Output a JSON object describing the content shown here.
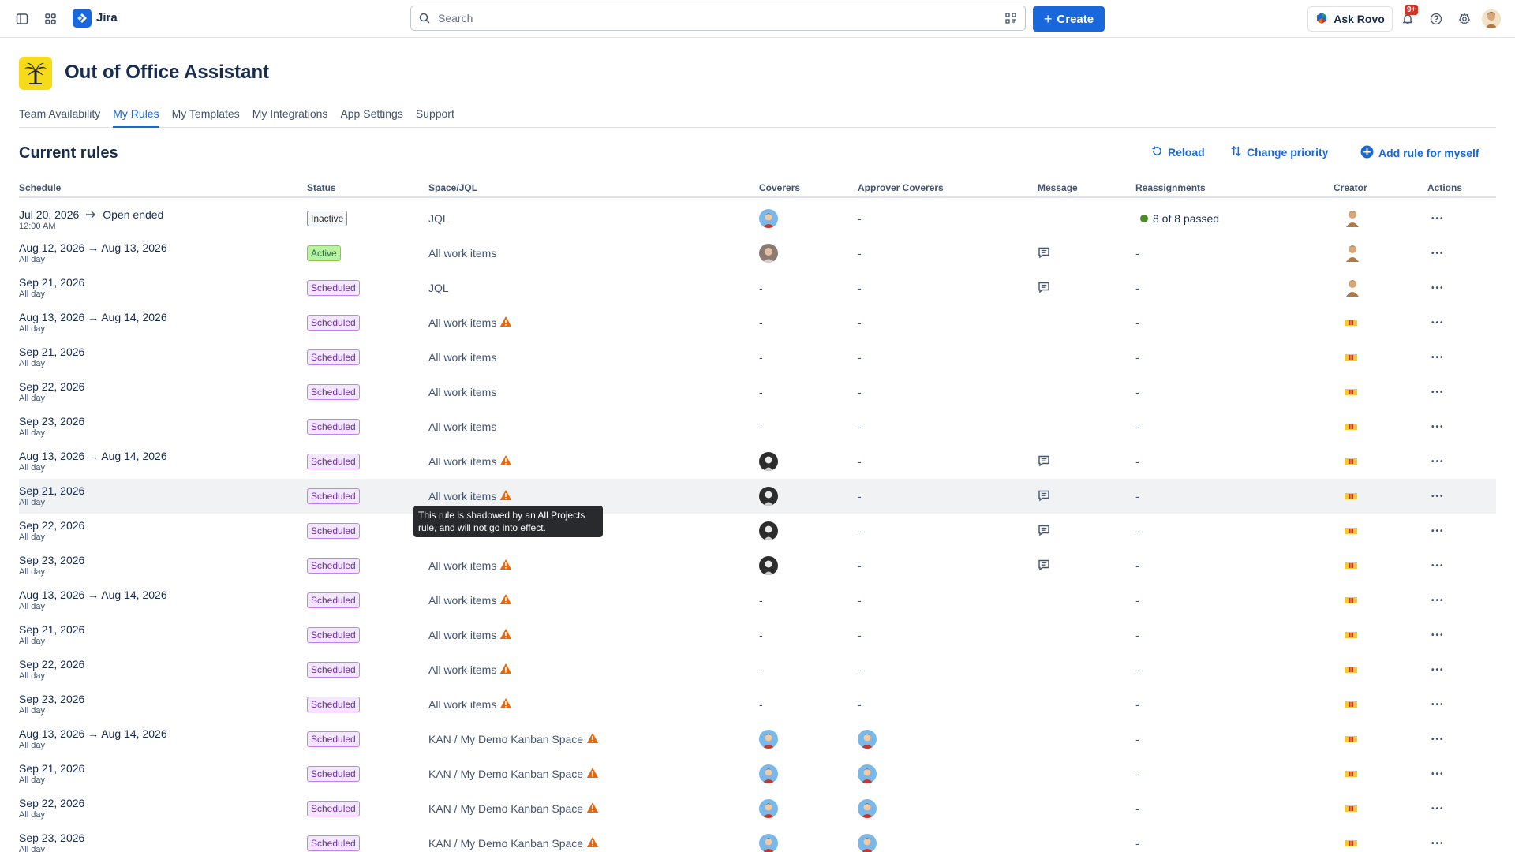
{
  "app": {
    "name": "Jira"
  },
  "search": {
    "placeholder": "Search"
  },
  "top": {
    "create_label": "Create",
    "ask_rovo_label": "Ask Rovo",
    "notifications_badge": "9+"
  },
  "page": {
    "title": "Out of Office Assistant",
    "section_title": "Current rules"
  },
  "tabs": [
    {
      "label": "Team Availability",
      "active": false
    },
    {
      "label": "My Rules",
      "active": true
    },
    {
      "label": "My Templates",
      "active": false
    },
    {
      "label": "My Integrations",
      "active": false
    },
    {
      "label": "App Settings",
      "active": false
    },
    {
      "label": "Support",
      "active": false
    }
  ],
  "actions": {
    "reload": "Reload",
    "change_priority": "Change priority",
    "add_rule": "Add rule for myself"
  },
  "columns": [
    "Schedule",
    "Status",
    "Space/JQL",
    "Coverers",
    "Approver Coverers",
    "Message",
    "Reassignments",
    "Creator",
    "Actions"
  ],
  "tooltip": {
    "text": "This rule is shadowed by an All Projects rule, and will not go into effect."
  },
  "rows": [
    {
      "schedule": "Jul 20, 2026",
      "schedule_end": "Open ended",
      "sub": "12:00 AM",
      "status": "Inactive",
      "space": "JQL",
      "warn": false,
      "coverer": "a",
      "approver": "-",
      "message": false,
      "reassign": "8 of 8 passed",
      "creator": "person"
    },
    {
      "schedule": "Aug 12, 2026 → Aug 13, 2026",
      "sub": "All day",
      "status": "Active",
      "space": "All work items",
      "warn": false,
      "coverer": "b",
      "approver": "-",
      "message": true,
      "reassign": "-",
      "creator": "person"
    },
    {
      "schedule": "Sep 21, 2026",
      "sub": "All day",
      "status": "Scheduled",
      "space": "JQL",
      "warn": false,
      "coverer": "-",
      "approver": "-",
      "message": true,
      "reassign": "-",
      "creator": "person"
    },
    {
      "schedule": "Aug 13, 2026 → Aug 14, 2026",
      "sub": "All day",
      "status": "Scheduled",
      "space": "All work items",
      "warn": true,
      "coverer": "-",
      "approver": "-",
      "message": false,
      "reassign": "-",
      "creator": "flag"
    },
    {
      "schedule": "Sep 21, 2026",
      "sub": "All day",
      "status": "Scheduled",
      "space": "All work items",
      "warn": false,
      "coverer": "-",
      "approver": "-",
      "message": false,
      "reassign": "-",
      "creator": "flag"
    },
    {
      "schedule": "Sep 22, 2026",
      "sub": "All day",
      "status": "Scheduled",
      "space": "All work items",
      "warn": false,
      "coverer": "-",
      "approver": "-",
      "message": false,
      "reassign": "-",
      "creator": "flag"
    },
    {
      "schedule": "Sep 23, 2026",
      "sub": "All day",
      "status": "Scheduled",
      "space": "All work items",
      "warn": false,
      "coverer": "-",
      "approver": "-",
      "message": false,
      "reassign": "-",
      "creator": "flag"
    },
    {
      "schedule": "Aug 13, 2026 → Aug 14, 2026",
      "sub": "All day",
      "status": "Scheduled",
      "space": "All work items",
      "warn": true,
      "coverer": "c",
      "approver": "-",
      "message": true,
      "reassign": "-",
      "creator": "flag"
    },
    {
      "schedule": "Sep 21, 2026",
      "sub": "All day",
      "status": "Scheduled",
      "space": "All work items",
      "warn": true,
      "coverer": "c",
      "approver": "-",
      "message": true,
      "reassign": "-",
      "creator": "flag",
      "hover": true
    },
    {
      "schedule": "Sep 22, 2026",
      "sub": "All day",
      "status": "Scheduled",
      "space": "",
      "warn": false,
      "coverer": "c",
      "approver": "-",
      "message": true,
      "reassign": "-",
      "creator": "flag"
    },
    {
      "schedule": "Sep 23, 2026",
      "sub": "All day",
      "status": "Scheduled",
      "space": "All work items",
      "warn": true,
      "coverer": "c",
      "approver": "-",
      "message": true,
      "reassign": "-",
      "creator": "flag"
    },
    {
      "schedule": "Aug 13, 2026 → Aug 14, 2026",
      "sub": "All day",
      "status": "Scheduled",
      "space": "All work items",
      "warn": true,
      "coverer": "-",
      "approver": "-",
      "message": false,
      "reassign": "-",
      "creator": "flag"
    },
    {
      "schedule": "Sep 21, 2026",
      "sub": "All day",
      "status": "Scheduled",
      "space": "All work items",
      "warn": true,
      "coverer": "-",
      "approver": "-",
      "message": false,
      "reassign": "-",
      "creator": "flag"
    },
    {
      "schedule": "Sep 22, 2026",
      "sub": "All day",
      "status": "Scheduled",
      "space": "All work items",
      "warn": true,
      "coverer": "-",
      "approver": "-",
      "message": false,
      "reassign": "-",
      "creator": "flag"
    },
    {
      "schedule": "Sep 23, 2026",
      "sub": "All day",
      "status": "Scheduled",
      "space": "All work items",
      "warn": true,
      "coverer": "-",
      "approver": "-",
      "message": false,
      "reassign": "-",
      "creator": "flag"
    },
    {
      "schedule": "Aug 13, 2026 → Aug 14, 2026",
      "sub": "All day",
      "status": "Scheduled",
      "space": "KAN / My Demo Kanban Space",
      "warn": true,
      "coverer": "a",
      "approver": "a",
      "message": false,
      "reassign": "-",
      "creator": "flag"
    },
    {
      "schedule": "Sep 21, 2026",
      "sub": "All day",
      "status": "Scheduled",
      "space": "KAN / My Demo Kanban Space",
      "warn": true,
      "coverer": "a",
      "approver": "a",
      "message": false,
      "reassign": "-",
      "creator": "flag"
    },
    {
      "schedule": "Sep 22, 2026",
      "sub": "All day",
      "status": "Scheduled",
      "space": "KAN / My Demo Kanban Space",
      "warn": true,
      "coverer": "a",
      "approver": "a",
      "message": false,
      "reassign": "-",
      "creator": "flag"
    },
    {
      "schedule": "Sep 23, 2026",
      "sub": "All day",
      "status": "Scheduled",
      "space": "KAN / My Demo Kanban Space",
      "warn": true,
      "coverer": "a",
      "approver": "a",
      "message": false,
      "reassign": "-",
      "creator": "flag"
    }
  ],
  "colors": {
    "accent": "#1868db",
    "warning": "#e56910",
    "success": "#22a06b",
    "scheduled": "#c97cf4"
  },
  "icons": [
    "sidebar-toggle-icon",
    "app-switcher-icon",
    "search-icon",
    "scan-icon",
    "plus-icon",
    "rovo-icon",
    "bell-icon",
    "help-icon",
    "gear-icon",
    "reload-icon",
    "sort-icon",
    "add-circle-icon",
    "arrow-right-icon",
    "warning-icon",
    "comment-icon",
    "more-icon"
  ]
}
